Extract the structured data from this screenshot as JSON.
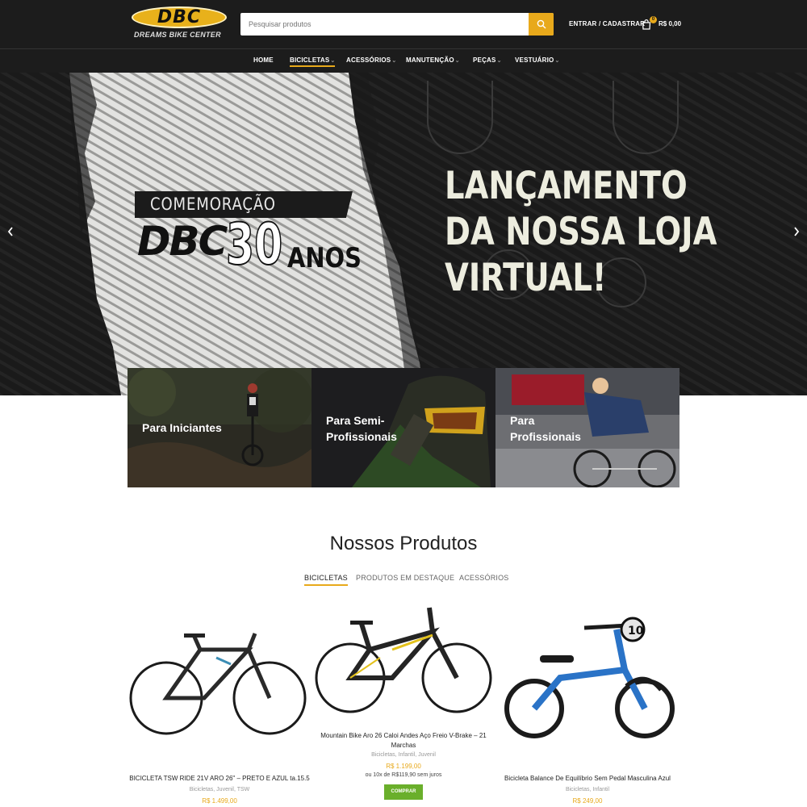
{
  "header": {
    "logo_text": "DBC",
    "logo_subtitle": "DREAMS BIKE CENTER",
    "search_placeholder": "Pesquisar produtos",
    "login_label": "ENTRAR / CADASTRAR",
    "cart_count": "0",
    "cart_total": "R$ 0,00"
  },
  "nav": {
    "items": [
      {
        "label": "HOME"
      },
      {
        "label": "BICICLETAS",
        "caret": "⌄"
      },
      {
        "label": "ACESSÓRIOS",
        "caret": "⌄"
      },
      {
        "label": "MANUTENÇÃO",
        "caret": "⌄"
      },
      {
        "label": "PEÇAS",
        "caret": "⌄"
      },
      {
        "label": "VESTUÁRIO",
        "caret": "⌄"
      }
    ]
  },
  "hero": {
    "subtitle": "COMEMORAÇÃO",
    "brand": "DBC",
    "number": "30",
    "anos": "ANOS",
    "headline_1": "LANÇAMENTO",
    "headline_2": "DA NOSSA LOJA",
    "headline_3": "VIRTUAL!",
    "slide_count": 3,
    "active_slide": 1
  },
  "categories": [
    {
      "line1": "Para Iniciantes",
      "line2": ""
    },
    {
      "line1": "Para Semi-",
      "line2": "Profissionais"
    },
    {
      "line1": "Para",
      "line2": "Profissionais"
    }
  ],
  "section": {
    "title": "Nossos Produtos",
    "tabs": [
      "BICICLETAS",
      "PRODUTOS EM DESTAQUE",
      "ACESSÓRIOS"
    ]
  },
  "products": [
    {
      "name": "BICICLETA TSW RIDE 21V ARO 26\" – PRETO E AZUL ta.15.5",
      "categories": "Bicicletas, Juvenil, TSW",
      "price": "R$ 1.499,00"
    },
    {
      "name_line1": "Mountain Bike Aro 26 Caloi Andes Aço Freio V-Brake – 21",
      "name_line2": "Marchas",
      "categories": "Bicicletas, Infantil, Juvenil",
      "price": "R$ 1.199,00",
      "installments": "ou 10x de R$119,90 sem juros",
      "button": "COMPRAR"
    },
    {
      "name": "Bicicleta Balance De Equilíbrio Sem Pedal Masculina Azul",
      "categories": "Bicicletas, Infantil",
      "price": "R$ 249,00"
    }
  ],
  "colors": {
    "accent": "#e8a91b",
    "dark": "#1c1c1c",
    "buy_button": "#6aaf2b"
  }
}
